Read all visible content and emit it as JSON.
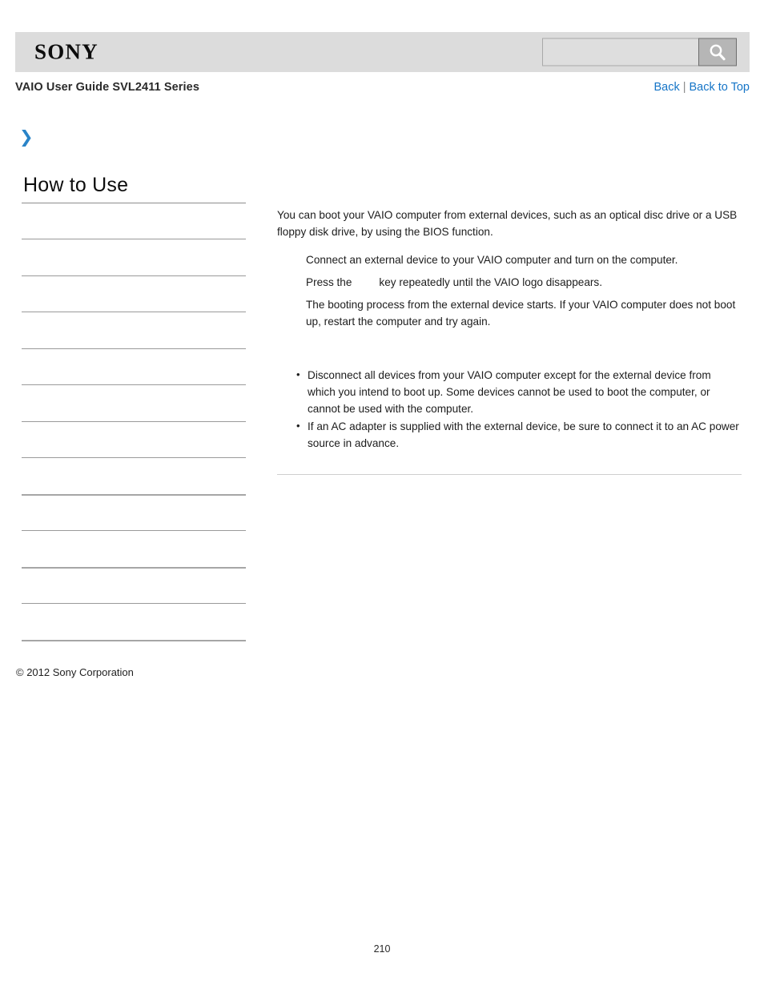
{
  "header": {
    "logo_text": "SONY",
    "search": {
      "value": "",
      "placeholder": "",
      "icon": "search-icon"
    }
  },
  "title_row": {
    "guide_title": "VAIO User Guide SVL2411 Series",
    "back_label": "Back",
    "separator": "|",
    "back_to_top_label": "Back to Top"
  },
  "breadcrumb": {
    "chevron_icon": "chevron-right-icon",
    "chevron_glyph": "❯"
  },
  "sidebar": {
    "heading": "How to Use",
    "items": [
      {
        "label": ""
      },
      {
        "label": ""
      },
      {
        "label": ""
      },
      {
        "label": ""
      },
      {
        "label": ""
      },
      {
        "label": ""
      },
      {
        "label": ""
      },
      {
        "label": ""
      },
      {
        "label": ""
      },
      {
        "label": ""
      },
      {
        "label": ""
      },
      {
        "label": ""
      }
    ]
  },
  "content": {
    "intro": "You can boot your VAIO computer from external devices, such as an optical disc drive or a USB floppy disk drive, by using the BIOS function.",
    "steps": [
      {
        "text_before": "Connect an external device to your VAIO computer and turn on the computer.",
        "text_after": ""
      },
      {
        "text_before": "Press the",
        "text_after": "key repeatedly until the VAIO logo disappears."
      },
      {
        "text_before": "The booting process from the external device starts. If your VAIO computer does not boot up, restart the computer and try again.",
        "text_after": ""
      }
    ],
    "notes": [
      "Disconnect all devices from your VAIO computer except for the external device from which you intend to boot up. Some devices cannot be used to boot the computer, or cannot be used with the computer.",
      "If an AC adapter is supplied with the external device, be sure to connect it to an AC power source in advance."
    ]
  },
  "footer": {
    "copyright": "© 2012 Sony Corporation",
    "page_number": "210"
  },
  "colors": {
    "header_bg": "#dcdcdc",
    "link_blue": "#1675c7",
    "chevron_blue": "#2a84c8",
    "rule_gray": "#9a9a9a"
  }
}
